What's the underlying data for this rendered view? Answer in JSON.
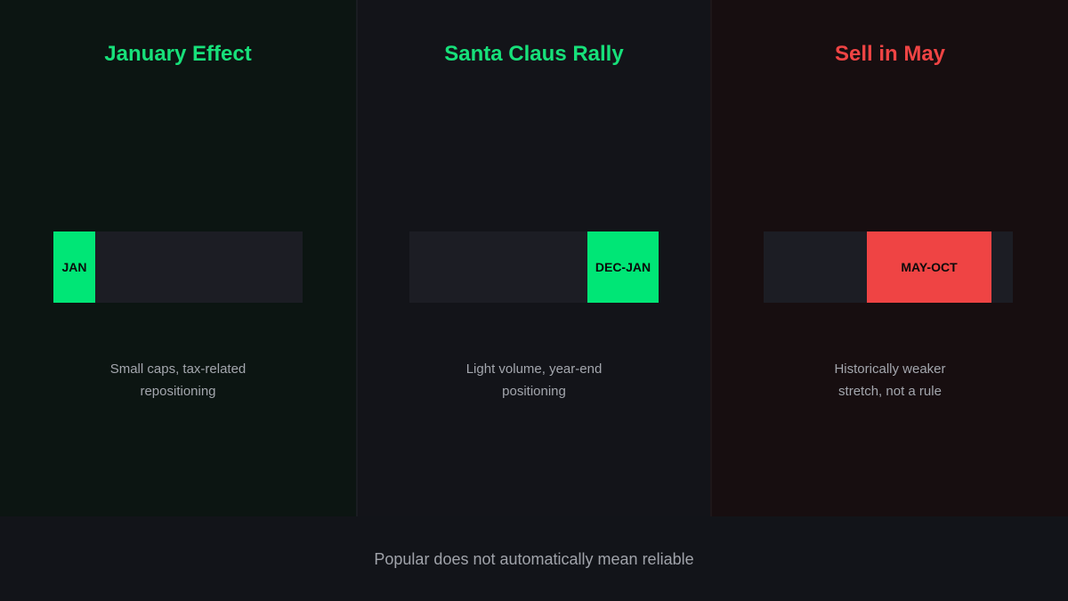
{
  "colors": {
    "positive": "#00e676",
    "negative": "#ef4444"
  },
  "panels": [
    {
      "title": "January Effect",
      "title_color": "#17e07a",
      "segment_label": "JAN",
      "segment_color": "#00e676",
      "desc_lines": [
        "Small caps, tax-related",
        "repositioning"
      ]
    },
    {
      "title": "Santa Claus Rally",
      "title_color": "#17e07a",
      "segment_label": "DEC-JAN",
      "segment_color": "#00e676",
      "desc_lines": [
        "Light volume, year-end",
        "positioning"
      ]
    },
    {
      "title": "Sell in May",
      "title_color": "#ef4444",
      "segment_label": "MAY-OCT",
      "segment_color": "#ef4444",
      "desc_lines": [
        "Historically weaker",
        "stretch, not a rule"
      ]
    }
  ],
  "footer": {
    "text": "Popular does not automatically mean reliable"
  }
}
